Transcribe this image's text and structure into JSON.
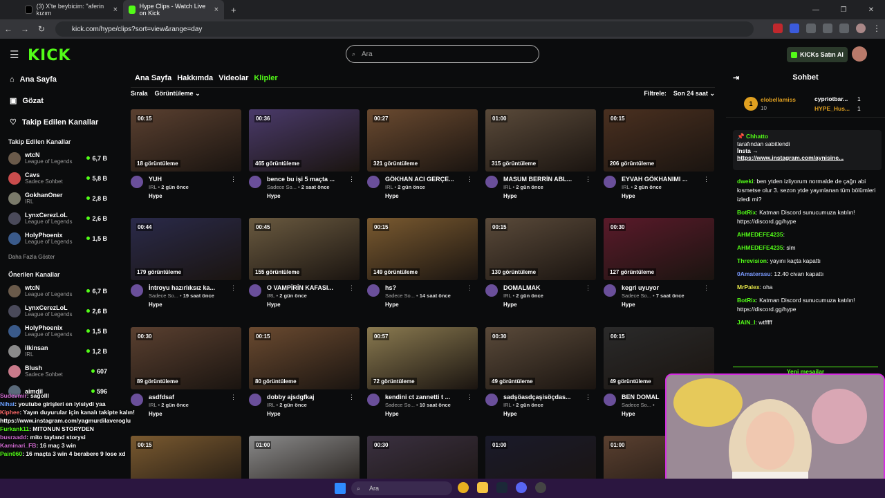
{
  "browser": {
    "tabs": [
      {
        "label": "(3) X'te beybicim: \"aferin kızım",
        "icon": "x-icon"
      },
      {
        "label": "Hype Clips - Watch Live on Kick",
        "icon": "kick-icon"
      }
    ],
    "url": "kick.com/hype/clips?sort=view&range=day"
  },
  "header": {
    "logo": "KICK",
    "search_placeholder": "Ara",
    "buy_button": "KICKs Satın Al"
  },
  "sidebar": {
    "nav": [
      {
        "label": "Ana Sayfa",
        "icon": "home-icon"
      },
      {
        "label": "Gözat",
        "icon": "browse-icon"
      },
      {
        "label": "Takip Edilen Kanallar",
        "icon": "heart-icon"
      }
    ],
    "followed_heading": "Takip Edilen Kanallar",
    "followed": [
      {
        "name": "wtcN",
        "game": "League of Legends",
        "viewers": "6,7 B",
        "color": "#6a5a4a"
      },
      {
        "name": "Cavs",
        "game": "Sadece Sohbet",
        "viewers": "5,8 B",
        "color": "#c94c4c"
      },
      {
        "name": "GokhanOner",
        "game": "IRL",
        "viewers": "2,8 B",
        "color": "#7a7a6a"
      },
      {
        "name": "LynxCerezLoL",
        "game": "League of Legends",
        "viewers": "2,6 B",
        "color": "#4a4a5a"
      },
      {
        "name": "HolyPhoenix",
        "game": "League of Legends",
        "viewers": "1,5 B",
        "color": "#3a5a8a"
      }
    ],
    "show_more": "Daha Fazla Göster",
    "recommended_heading": "Önerilen Kanallar",
    "recommended": [
      {
        "name": "wtcN",
        "game": "League of Legends",
        "viewers": "6,7 B",
        "color": "#6a5a4a"
      },
      {
        "name": "LynxCerezLoL",
        "game": "League of Legends",
        "viewers": "2,6 B",
        "color": "#4a4a5a"
      },
      {
        "name": "HolyPhoenix",
        "game": "League of Legends",
        "viewers": "1,5 B",
        "color": "#3a5a8a"
      },
      {
        "name": "ilkinsan",
        "game": "IRL",
        "viewers": "1,2 B",
        "color": "#8a8a8a"
      },
      {
        "name": "Blush",
        "game": "Sadece Sohbet",
        "viewers": "607",
        "color": "#c97a8a"
      },
      {
        "name": "aimdil",
        "game": "",
        "viewers": "596",
        "color": "#5a6a7a"
      }
    ]
  },
  "main": {
    "tabs": [
      "Ana Sayfa",
      "Hakkımda",
      "Videolar",
      "Klipler"
    ],
    "sort_label": "Sırala",
    "sort_value": "Görüntüleme",
    "filter_label": "Filtrele:",
    "filter_value": "Son 24 saat",
    "clips": [
      {
        "duration": "00:15",
        "views": "18 görüntüleme",
        "title": "YUH",
        "sub": "IRL",
        "age": "2 gün önce",
        "category": "Hype",
        "thumb": "#5a4030"
      },
      {
        "duration": "00:36",
        "views": "465 görüntüleme",
        "title": "bence bu işi 5 maçta ...",
        "sub": "Sadece So...",
        "age": "2 saat önce",
        "category": "Hype",
        "thumb": "#4a3a6a"
      },
      {
        "duration": "00:27",
        "views": "321 görüntüleme",
        "title": "GÖKHAN ACI GERÇE...",
        "sub": "IRL",
        "age": "2 gün önce",
        "category": "Hype",
        "thumb": "#6a4a30"
      },
      {
        "duration": "01:00",
        "views": "315 görüntüleme",
        "title": "MASUM BERRİN ABL...",
        "sub": "IRL",
        "age": "2 gün önce",
        "category": "Hype",
        "thumb": "#5a4a3a"
      },
      {
        "duration": "00:15",
        "views": "206 görüntüleme",
        "title": "EYVAH GÖKHANIMI ...",
        "sub": "IRL",
        "age": "2 gün önce",
        "category": "Hype",
        "thumb": "#4a3020"
      },
      {
        "duration": "00:44",
        "views": "179 görüntüleme",
        "title": "İntroyu hazırlıksız ka...",
        "sub": "Sadece So...",
        "age": "19 saat önce",
        "category": "Hype",
        "thumb": "#2a2a4a"
      },
      {
        "duration": "00:45",
        "views": "155 görüntüleme",
        "title": "O VAMPİRİN KAFASI...",
        "sub": "IRL",
        "age": "2 gün önce",
        "category": "Hype",
        "thumb": "#6a5a40"
      },
      {
        "duration": "00:15",
        "views": "149 görüntüleme",
        "title": "hs?",
        "sub": "Sadece So...",
        "age": "14 saat önce",
        "category": "Hype",
        "thumb": "#7a5a30"
      },
      {
        "duration": "00:15",
        "views": "130 görüntüleme",
        "title": "DOMALMAK",
        "sub": "IRL",
        "age": "2 gün önce",
        "category": "Hype",
        "thumb": "#5a4a3a"
      },
      {
        "duration": "00:30",
        "views": "127 görüntüleme",
        "title": "kegri uyuyor",
        "sub": "Sadece So...",
        "age": "7 saat önce",
        "category": "Hype",
        "thumb": "#5a1a2a"
      },
      {
        "duration": "00:30",
        "views": "89 görüntüleme",
        "title": "asdfdsaf",
        "sub": "IRL",
        "age": "2 gün önce",
        "category": "Hype",
        "thumb": "#5a4030"
      },
      {
        "duration": "00:15",
        "views": "80 görüntüleme",
        "title": "dobby ajsdgfkaj",
        "sub": "IRL",
        "age": "2 gün önce",
        "category": "Hype",
        "thumb": "#6a4a30"
      },
      {
        "duration": "00:57",
        "views": "72 görüntüleme",
        "title": "kendini ct zannetti t ...",
        "sub": "Sadece So...",
        "age": "10 saat önce",
        "category": "Hype",
        "thumb": "#8a7a50"
      },
      {
        "duration": "00:30",
        "views": "49 görüntüleme",
        "title": "sadşöasdçaşisöçdas...",
        "sub": "IRL",
        "age": "2 gün önce",
        "category": "Hype",
        "thumb": "#5a4a3a"
      },
      {
        "duration": "00:15",
        "views": "49 görüntüleme",
        "title": "BEN DOMAL",
        "sub": "Sadece So...",
        "age": "",
        "category": "Hype",
        "thumb": "#2a2a2a"
      },
      {
        "duration": "00:15",
        "views": "",
        "title": "",
        "sub": "",
        "age": "",
        "category": "",
        "thumb": "#7a5a30"
      },
      {
        "duration": "01:00",
        "views": "",
        "title": "",
        "sub": "",
        "age": "",
        "category": "",
        "thumb": "#8a8a8a"
      },
      {
        "duration": "00:30",
        "views": "",
        "title": "",
        "sub": "",
        "age": "",
        "category": "",
        "thumb": "#3a3040"
      },
      {
        "duration": "01:00",
        "views": "",
        "title": "",
        "sub": "",
        "age": "",
        "category": "",
        "thumb": "#1a1a2a"
      },
      {
        "duration": "01:00",
        "views": "",
        "title": "",
        "sub": "",
        "age": "",
        "category": "",
        "thumb": "#5a4030"
      }
    ]
  },
  "chat": {
    "title": "Sohbet",
    "leaderboard": [
      {
        "rank": "1",
        "name": "elobellamiss",
        "value": "10"
      },
      {
        "name": "cypriotbar...",
        "value": "1"
      },
      {
        "name": "HYPE_Hus...",
        "value": "1"
      }
    ],
    "pinned_user": "Chhatto",
    "pinned_by": "tarafından sabitlendi",
    "pinned_text": "İnsta →",
    "pinned_link": "https://www.instagram.com/aynisine...",
    "messages": [
      {
        "user": "dweki",
        "color": "#53fc18",
        "text": "ben ytden izliyorum normalde de çağrı abi kısmetse olur 3. sezon ytde yayınlanan tüm bölümleri izledi mi?"
      },
      {
        "user": "BotRix",
        "color": "#53fc18",
        "text": "Katman Discord sunucumuza katılın! https://discord.gg/hype"
      },
      {
        "user": "AHMEDEFE4235",
        "color": "#53fc18",
        "text": ""
      },
      {
        "user": "AHMEDEFE4235",
        "color": "#53fc18",
        "text": "slm"
      },
      {
        "user": "Threvision",
        "color": "#53fc18",
        "text": "yayını kaçta kapattı"
      },
      {
        "user": "0Amaterasu",
        "color": "#7a9aff",
        "text": "12.40 civarı kapattı"
      },
      {
        "user": "MrPalex",
        "color": "#e8e84a",
        "text": "oha"
      },
      {
        "user": "BotRix",
        "color": "#53fc18",
        "text": "Katman Discord sunucumuza katılın! https://discord.gg/hype"
      },
      {
        "user": "JAIN_I",
        "color": "#53fc18",
        "text": "wtfffff"
      }
    ],
    "new_messages": "Yeni mesajlar"
  },
  "overlay_chat": [
    {
      "user": "Sudevmir",
      "text": ": sağolll",
      "color": "#d06ad0"
    },
    {
      "user": "Nihat",
      "text": ": youtube girişleri en iyisiydi yaa",
      "color": "#6aa0ff"
    },
    {
      "user": "Kiphee",
      "text": ": Yayın duyurular için kanalı takipte kalın!",
      "color": "#ff6a6a"
    },
    {
      "user": "",
      "text": "https://www.instagram.com/yagmurdilaveroglu",
      "color": "#fff"
    },
    {
      "user": "Furkank11",
      "text": ": MITONUN STORYDEN",
      "color": "#53fc18"
    },
    {
      "user": "busraadd",
      "text": ": mito tayland storysi",
      "color": "#d06ad0"
    },
    {
      "user": "Kaminari_FB",
      "text": ": 16 maç 3 win",
      "color": "#d06ad0"
    },
    {
      "user": "Pain060",
      "text": ": 16 maçta 3 win 4 berabere 9 lose xd",
      "color": "#53fc18"
    }
  ],
  "taskbar": {
    "search": "Ara"
  }
}
